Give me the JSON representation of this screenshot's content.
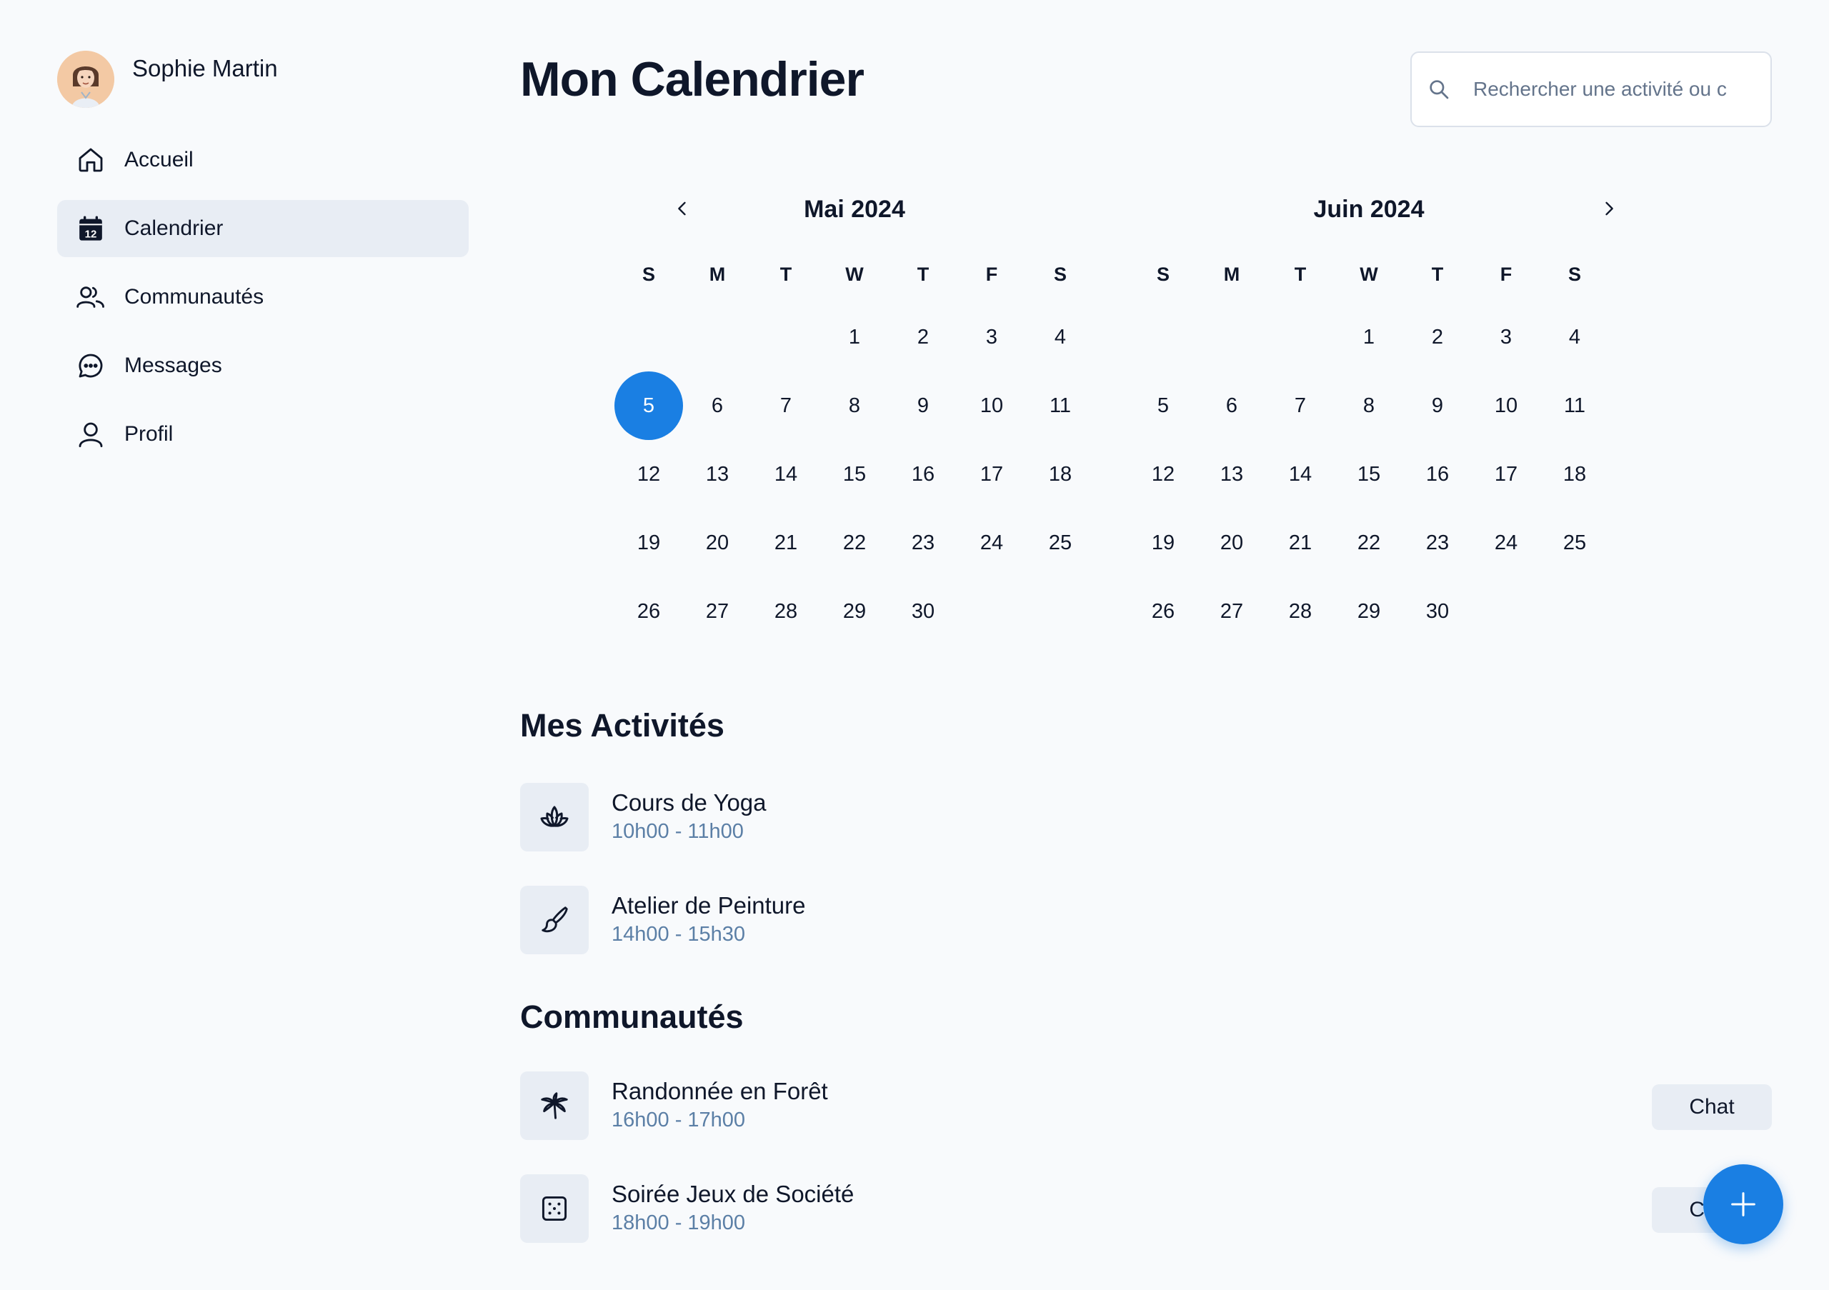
{
  "profile": {
    "name": "Sophie Martin",
    "avatar_icon": "woman-avatar"
  },
  "nav": [
    {
      "label": "Accueil",
      "icon": "home-icon",
      "active": false
    },
    {
      "label": "Calendrier",
      "icon": "calendar-icon",
      "active": true,
      "icon_number": "12"
    },
    {
      "label": "Communautés",
      "icon": "users-icon",
      "active": false
    },
    {
      "label": "Messages",
      "icon": "chat-bubble-icon",
      "active": false
    },
    {
      "label": "Profil",
      "icon": "user-icon",
      "active": false
    }
  ],
  "header": {
    "title": "Mon Calendrier",
    "search_placeholder": "Rechercher une activité ou c"
  },
  "calendar": {
    "weekdays": [
      "S",
      "M",
      "T",
      "W",
      "T",
      "F",
      "S"
    ],
    "selected_day": 5,
    "accent": "#1a7fe3",
    "months": [
      {
        "title": "Mai 2024",
        "days": [
          "",
          "",
          "",
          "1",
          "2",
          "3",
          "4",
          "5",
          "6",
          "7",
          "8",
          "9",
          "10",
          "11",
          "12",
          "13",
          "14",
          "15",
          "16",
          "17",
          "18",
          "19",
          "20",
          "21",
          "22",
          "23",
          "24",
          "25",
          "26",
          "27",
          "28",
          "29",
          "30"
        ]
      },
      {
        "title": "Juin 2024",
        "days": [
          "",
          "",
          "",
          "1",
          "2",
          "3",
          "4",
          "5",
          "6",
          "7",
          "8",
          "9",
          "10",
          "11",
          "12",
          "13",
          "14",
          "15",
          "16",
          "17",
          "18",
          "19",
          "20",
          "21",
          "22",
          "23",
          "24",
          "25",
          "26",
          "27",
          "28",
          "29",
          "30"
        ]
      }
    ]
  },
  "activities": {
    "title": "Mes Activités",
    "items": [
      {
        "title": "Cours de Yoga",
        "time": "10h00 - 11h00",
        "icon": "lotus-icon"
      },
      {
        "title": "Atelier de Peinture",
        "time": "14h00 - 15h30",
        "icon": "paintbrush-icon"
      }
    ]
  },
  "communities": {
    "title": "Communautés",
    "items": [
      {
        "title": "Randonnée en Forêt",
        "time": "16h00 - 17h00",
        "icon": "palm-tree-icon",
        "action": "Chat"
      },
      {
        "title": "Soirée Jeux de Société",
        "time": "18h00 - 19h00",
        "icon": "dice-icon",
        "action": "Chat"
      }
    ]
  },
  "colors": {
    "accent": "#1a7fe3",
    "background": "#f8fafc",
    "time_text": "#5b7fa6",
    "tile_bg": "#e8edf4"
  }
}
